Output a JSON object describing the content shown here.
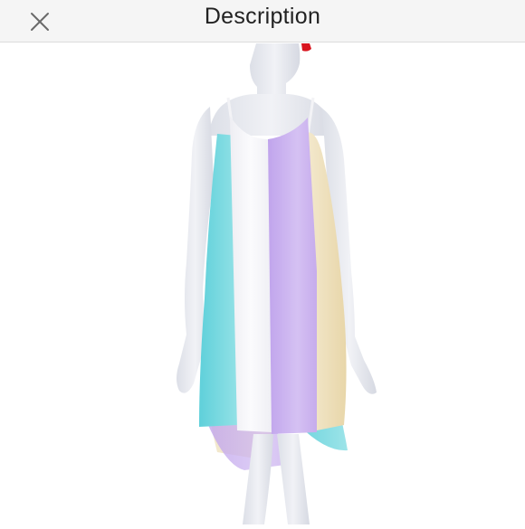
{
  "header": {
    "title": "Description",
    "close_icon": "close-icon"
  },
  "photo": {
    "subject": "mannequin-in-dress-image",
    "colors": {
      "mannequin": "#e9ebf1",
      "white_panel": "#f6f6f8",
      "aqua_panel": "#7fd9e0",
      "lavender_panel": "#c9b0ee",
      "cream_panel": "#f0e2bf",
      "lips": "#d8141e"
    }
  }
}
